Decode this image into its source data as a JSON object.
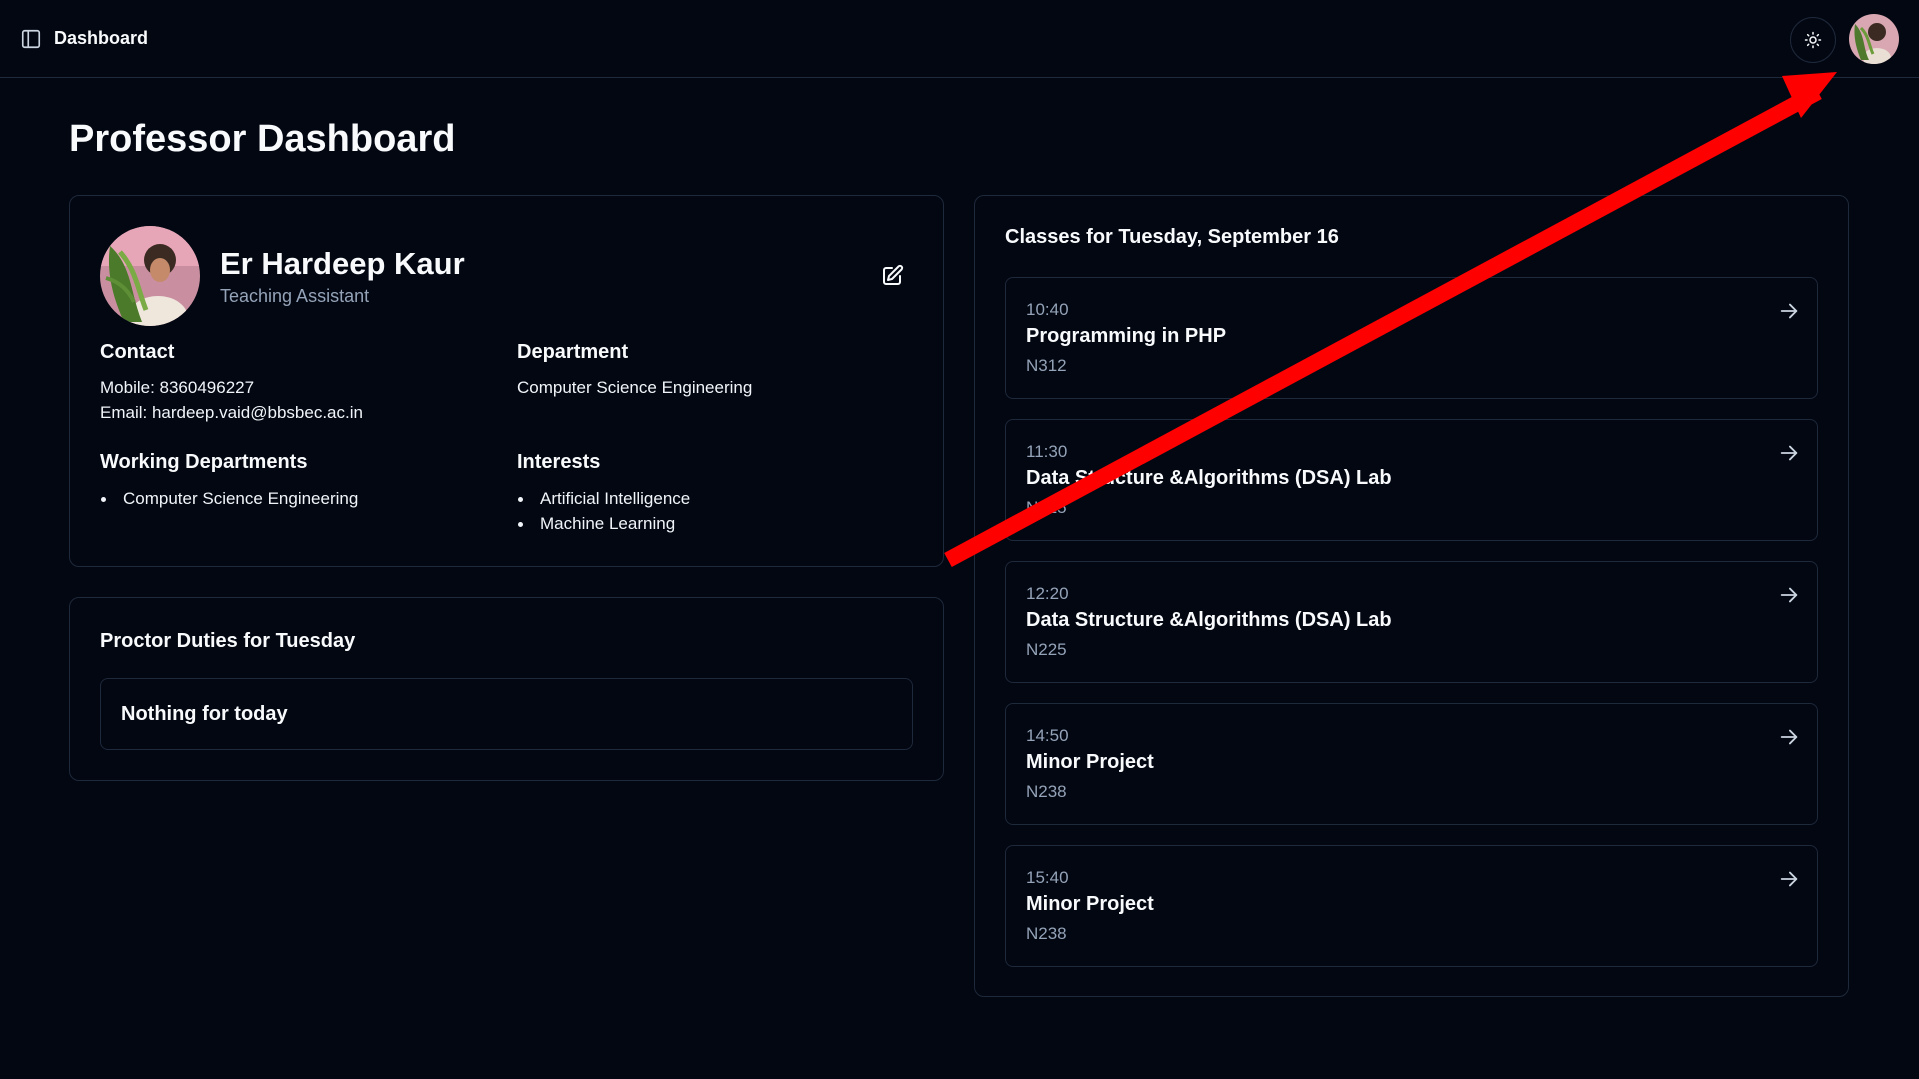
{
  "topbar": {
    "title": "Dashboard",
    "icons": {
      "sidebar": "sidebar-toggle-icon",
      "theme": "sun-icon",
      "avatar": "user-avatar"
    }
  },
  "page": {
    "title": "Professor Dashboard"
  },
  "profile": {
    "name": "Er Hardeep Kaur",
    "role": "Teaching Assistant",
    "contact": {
      "heading": "Contact",
      "mobile": "Mobile: 8360496227",
      "email": "Email: hardeep.vaid@bbsbec.ac.in"
    },
    "department": {
      "heading": "Department",
      "value": "Computer Science Engineering"
    },
    "working_departments": {
      "heading": "Working Departments",
      "items": [
        "Computer Science Engineering"
      ]
    },
    "interests": {
      "heading": "Interests",
      "items": [
        "Artificial Intelligence",
        "Machine Learning"
      ]
    }
  },
  "proctor": {
    "heading": "Proctor Duties for Tuesday",
    "empty_text": "Nothing for today"
  },
  "classes": {
    "heading": "Classes for Tuesday, September 16",
    "items": [
      {
        "time": "10:40",
        "name": "Programming in PHP",
        "room": "N312"
      },
      {
        "time": "11:30",
        "name": "Data Structure &Algorithms (DSA) Lab",
        "room": "N225"
      },
      {
        "time": "12:20",
        "name": "Data Structure &Algorithms (DSA) Lab",
        "room": "N225"
      },
      {
        "time": "14:50",
        "name": "Minor Project",
        "room": "N238"
      },
      {
        "time": "15:40",
        "name": "Minor Project",
        "room": "N238"
      }
    ]
  },
  "colors": {
    "background": "#030712",
    "border": "#1e293b",
    "muted_text": "#94a3b8",
    "annotation_arrow": "#ff0000"
  }
}
